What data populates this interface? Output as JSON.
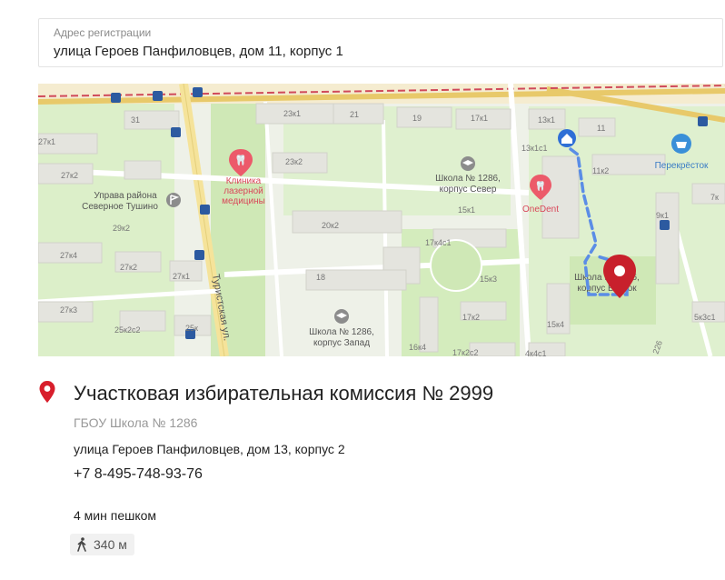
{
  "address_field": {
    "label": "Адрес регистрации",
    "value": "улица Героев Панфиловцев, дом 11, корпус 1"
  },
  "map": {
    "accent": "#d81e2c",
    "route_color": "#5b8de6",
    "labels": {
      "b23k1": "23к1",
      "b21": "21",
      "b19": "19",
      "b17k1": "17к1",
      "b13k1": "13к1",
      "b11": "11",
      "b31": "31",
      "b27k1": "27к1",
      "b27k2": "27к2",
      "b23k2": "23к2",
      "b13k1s1": "13к1с1",
      "b11k2": "11к2",
      "b29k2": "29к2",
      "b20k2": "20к2",
      "b15k1": "15к1",
      "b9k1": "9к1",
      "b7k": "7к",
      "b27k4": "27к4",
      "b27k2b": "27к2",
      "b27k1b": "27к1",
      "b17k4s1": "17к4с1",
      "b15k3": "15к3",
      "b18": "18",
      "b27k3": "27к3",
      "b25k2s2": "25к2с2",
      "b25k": "25к",
      "b17k2": "17к2",
      "b16k4": "16к4",
      "b17k2s2": "17к2с2",
      "b15k4": "15к4",
      "b4k4s1": "4к4с1",
      "b5k3s1": "5к3с1",
      "b226": "226"
    },
    "clinic_line1": "Клиника",
    "clinic_line2": "лазерной",
    "clinic_line3": "медицины",
    "uprava_line1": "Управа района",
    "uprava_line2": "Северное Тушино",
    "school_north_line1": "Школа № 1286,",
    "school_north_line2": "корпус Север",
    "school_west_line1": "Школа № 1286,",
    "school_west_line2": "корпус Запад",
    "school_east_line1": "Школа № 1286,",
    "school_east_line2": "корпус Восток",
    "onedent": "OneDent",
    "perekrestok": "Перекрёсток",
    "street": "Туристская ул."
  },
  "commission": {
    "title": "Участковая избирательная комиссия № 2999",
    "organization": "ГБОУ Школа № 1286",
    "address": "улица Героев Панфиловцев, дом 13, корпус 2",
    "phone": "+7 8-495-748-93-76"
  },
  "walk": {
    "time": "4 мин пешком",
    "distance": "340 м"
  }
}
